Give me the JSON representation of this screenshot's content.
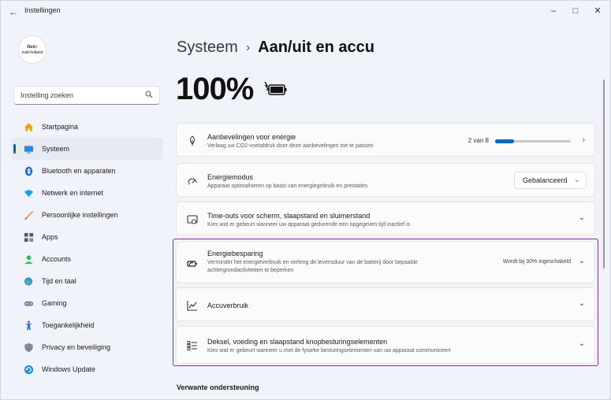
{
  "window": {
    "title": "Instellingen",
    "back_glyph": "←",
    "minimize_glyph": "–",
    "maximize_glyph": "□",
    "close_glyph": "✕"
  },
  "account": {
    "logo_line1": "hcc",
    "logo_dot": "•",
    "logo_line2": "zuid-holland"
  },
  "search": {
    "placeholder": "Instelling zoeken",
    "icon": "search-icon"
  },
  "sidebar": {
    "items": [
      {
        "label": "Startpagina",
        "icon": "home-icon",
        "active": false
      },
      {
        "label": "Systeem",
        "icon": "monitor-icon",
        "active": true
      },
      {
        "label": "Bluetooth en apparaten",
        "icon": "bluetooth-icon",
        "active": false
      },
      {
        "label": "Netwerk en internet",
        "icon": "wifi-icon",
        "active": false
      },
      {
        "label": "Persoonlijke instellingen",
        "icon": "brush-icon",
        "active": false
      },
      {
        "label": "Apps",
        "icon": "apps-icon",
        "active": false
      },
      {
        "label": "Accounts",
        "icon": "person-icon",
        "active": false
      },
      {
        "label": "Tijd en taal",
        "icon": "globe-clock-icon",
        "active": false
      },
      {
        "label": "Gaming",
        "icon": "gamepad-icon",
        "active": false
      },
      {
        "label": "Toegankelijkheid",
        "icon": "accessibility-icon",
        "active": false
      },
      {
        "label": "Privacy en beveiliging",
        "icon": "shield-icon",
        "active": false
      },
      {
        "label": "Windows Update",
        "icon": "update-icon",
        "active": false
      }
    ]
  },
  "header": {
    "parent": "Systeem",
    "separator": "›",
    "current": "Aan/uit en accu"
  },
  "battery": {
    "percent_label": "100%",
    "level": 1.0,
    "icon": "battery-charging-icon"
  },
  "cards": {
    "recommendations": {
      "title": "Aanbevelingen voor energie",
      "desc": "Verlaag uw CO2-voetafdruk door deze aanbevelingen toe te passen",
      "progress_label": "2 van 8",
      "progress_fraction": 0.25,
      "icon": "leaf-icon"
    },
    "power_mode": {
      "title": "Energiemodus",
      "desc": "Apparaat optimaliseren op basis van energiegebruik en prestaties",
      "selected": "Gebalanceerd",
      "icon": "gauge-icon"
    },
    "timeouts": {
      "title": "Time-outs voor scherm, slaapstand en sluimerstand",
      "desc": "Kies wat er gebeurt wanneer uw apparaat gedurende een opgegeven tijd inactief is",
      "icon": "screen-timeout-icon"
    },
    "energy_saver": {
      "title": "Energiebesparing",
      "desc_line1": "Verminder het energieverbruik en verleng de levensduur van de batterij door bepaalde",
      "desc_line2": "achtergrondactiviteiten te beperken",
      "status": "Wordt bij 30% ingeschakeld",
      "icon": "battery-saver-icon"
    },
    "battery_usage": {
      "title": "Accuverbruik",
      "icon": "chart-line-icon"
    },
    "lid_power": {
      "title": "Deksel, voeding en slaapstand knopbesturingselementen",
      "desc": "Kies wat er gebeurt wanneer u met de fysieke besturingselementen van uw apparaat communiceert",
      "icon": "list-icon"
    }
  },
  "related": {
    "heading": "Verwante ondersteuning"
  },
  "colors": {
    "accent": "#0067c0",
    "highlight_border": "#7a3b8f"
  }
}
